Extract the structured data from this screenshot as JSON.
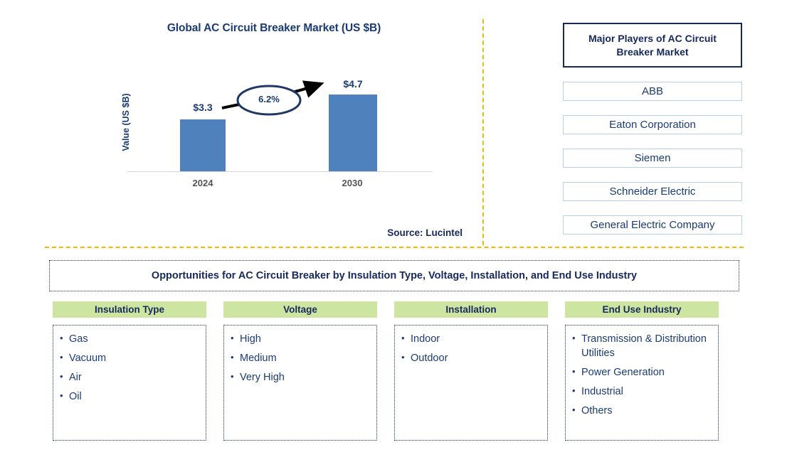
{
  "chart_data": {
    "type": "bar",
    "title": "Global AC Circuit Breaker Market (US $B)",
    "xlabel": "",
    "ylabel": "Value (US $B)",
    "categories": [
      "2024",
      "2030"
    ],
    "values": [
      3.3,
      4.7
    ],
    "value_labels": [
      "$3.3",
      "$4.7"
    ],
    "annotation": "6.2%",
    "annotation_note": "CAGR growth arrow from 2024 bar to 2030 bar",
    "ylim": [
      0,
      5.6
    ],
    "grid": false,
    "legend": false,
    "bar_color": "#4f81bd",
    "source": "Source: Lucintel"
  },
  "chart": {
    "title": "Global AC Circuit Breaker Market (US $B)",
    "y_axis_label": "Value (US $B)",
    "cagr": "6.2%",
    "bars": [
      {
        "category": "2024",
        "label": "$3.3"
      },
      {
        "category": "2030",
        "label": "$4.7"
      }
    ],
    "source": "Source: Lucintel"
  },
  "players": {
    "header": "Major Players of AC Circuit Breaker Market",
    "items": [
      "ABB",
      "Eaton Corporation",
      "Siemen",
      "Schneider Electric",
      "General Electric Company"
    ]
  },
  "opportunities": {
    "banner": "Opportunities for AC Circuit Breaker by Insulation Type, Voltage, Installation, and End Use Industry",
    "columns": [
      {
        "header": "Insulation Type",
        "items": [
          "Gas",
          "Vacuum",
          "Air",
          "Oil"
        ]
      },
      {
        "header": "Voltage",
        "items": [
          "High",
          "Medium",
          "Very High"
        ]
      },
      {
        "header": "Installation",
        "items": [
          "Indoor",
          "Outdoor"
        ]
      },
      {
        "header": "End Use Industry",
        "items": [
          "Transmission & Distribution Utilities",
          "Power Generation",
          "Industrial",
          "Others"
        ]
      }
    ]
  },
  "colors": {
    "bar": "#4f81bd",
    "navy": "#17295c",
    "title_blue": "#1a3b73",
    "divider_gold": "#f9b800",
    "header_green": "#cde5a1",
    "player_border": "#b6cfe6"
  }
}
